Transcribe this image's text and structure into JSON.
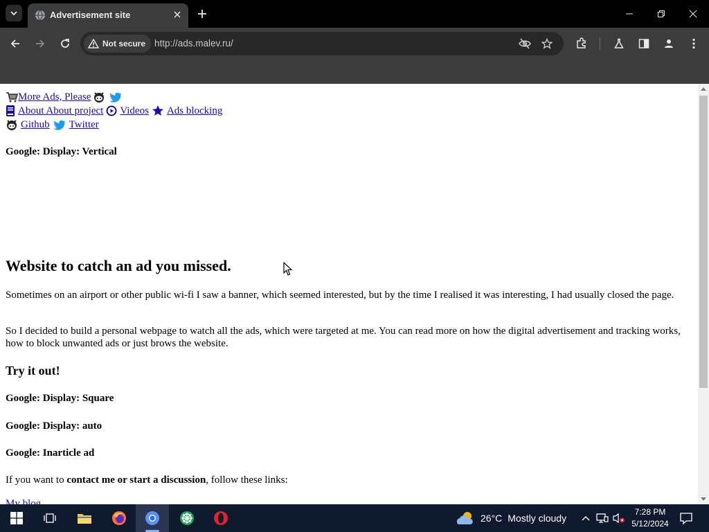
{
  "browser": {
    "tab_title": "Advertisement site",
    "security_label": "Not secure",
    "url": "http://ads.malev.ru/"
  },
  "page": {
    "nav": {
      "line1": {
        "more_ads": "More Ads, Please"
      },
      "line2": {
        "about": "About About project",
        "videos": "Videos",
        "ads_blocking": "Ads blocking"
      },
      "line3": {
        "github": "Github",
        "twitter": "Twitter"
      }
    },
    "ad_vertical": "Google: Display: Vertical",
    "main_heading": "Website to catch an ad you missed.",
    "paragraph1": "Sometimes on an airport or other public wi-fi I saw a banner, which seemed interested, but by the time I realised it was interesting, I had usually closed the page.",
    "paragraph2": "So I decided to build a personal webpage to watch all the ads, which were targeted at me. You can read more on how the digital advertisement and tracking works, how to block unwanted ads or just brows the website.",
    "try_heading": "Try it out!",
    "ad_square": "Google: Display: Square",
    "ad_auto": "Google: Display: auto",
    "ad_inarticle": "Google: Inarticle ad",
    "contact_prefix": "If you want to ",
    "contact_bold": "contact me or start a discussion",
    "contact_suffix": ", follow these links:",
    "blog_link": "My blog"
  },
  "taskbar": {
    "weather_temp": "26°C",
    "weather_desc": "Mostly cloudy",
    "time": "7:28 PM",
    "date": "5/12/2024"
  },
  "colors": {
    "link": "#1a0dab",
    "chrome_dark": "#3c3c3c",
    "taskbar": "#101a2e"
  }
}
